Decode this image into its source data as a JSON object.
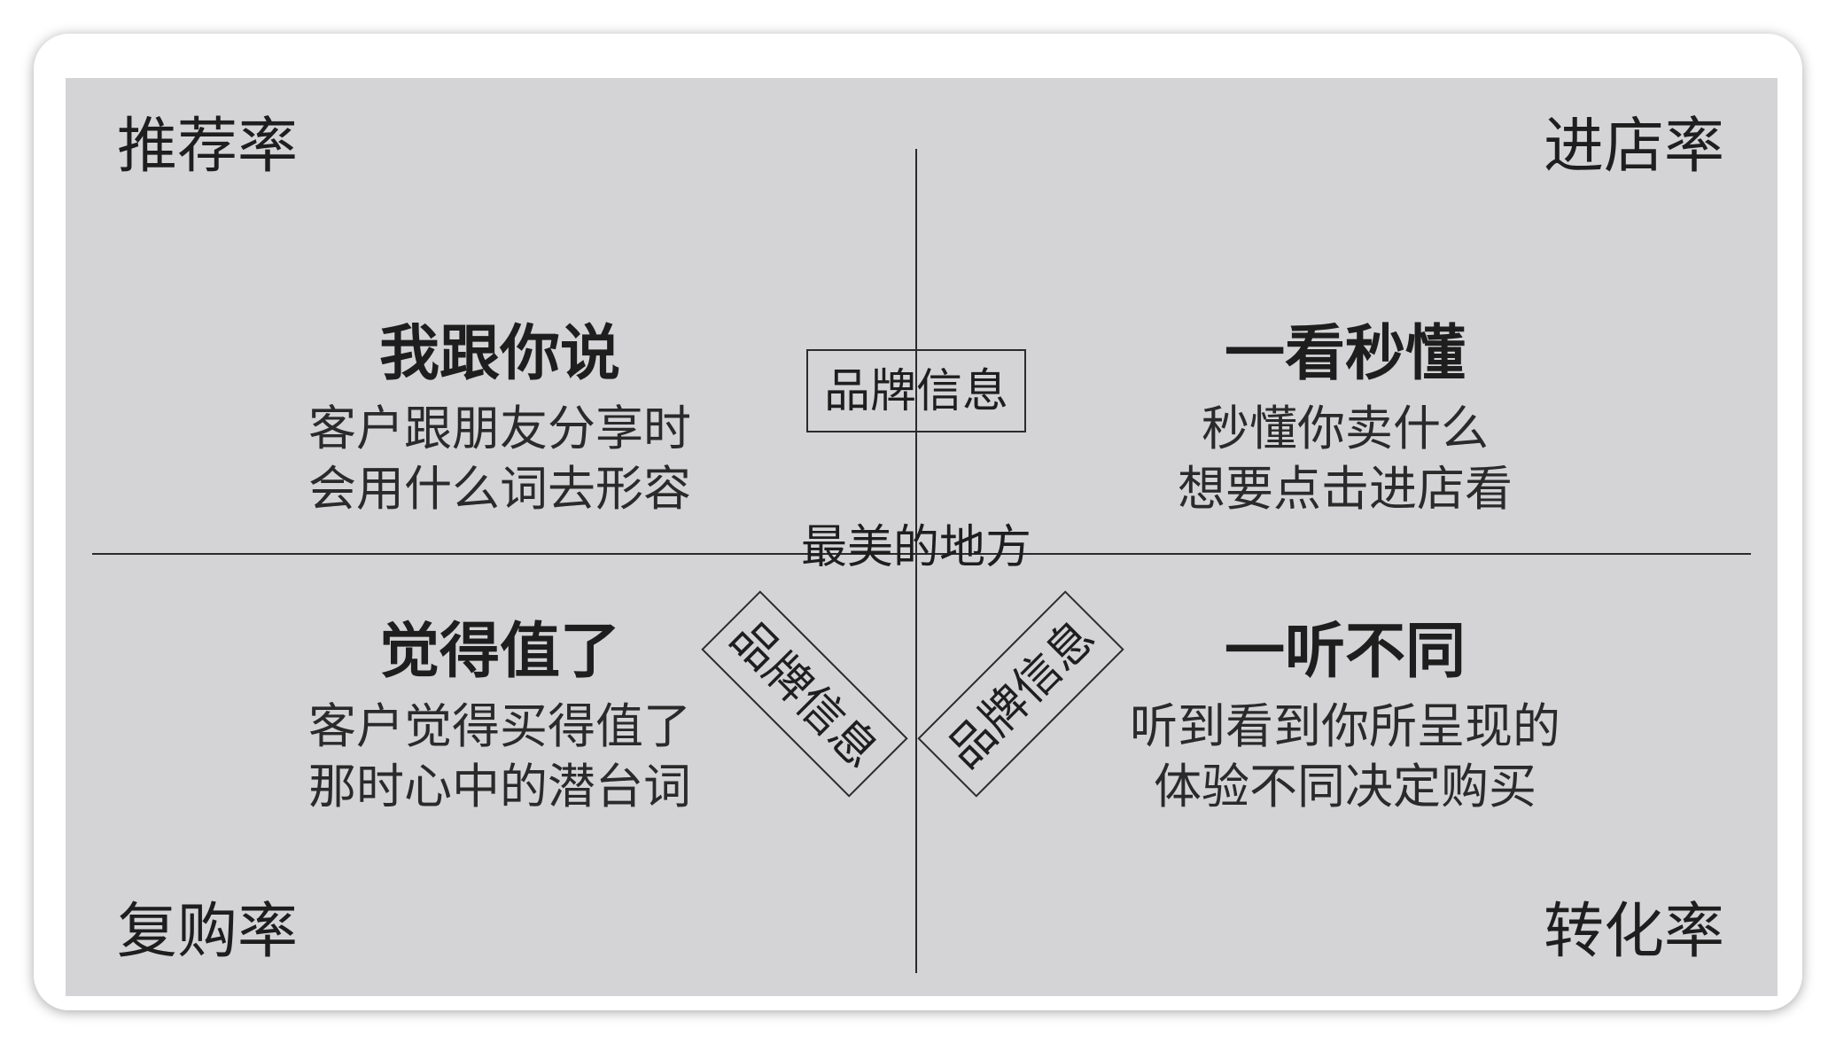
{
  "corners": {
    "top_left": "推荐率",
    "top_right": "进店率",
    "bottom_left": "复购率",
    "bottom_right": "转化率"
  },
  "quadrants": {
    "top_left": {
      "title": "我跟你说",
      "lines": [
        "客户跟朋友分享时",
        "会用什么词去形容"
      ]
    },
    "top_right": {
      "title": "一看秒懂",
      "lines": [
        "秒懂你卖什么",
        "想要点击进店看"
      ]
    },
    "bottom_left": {
      "title": "觉得值了",
      "lines": [
        "客户觉得买得值了",
        "那时心中的潜台词"
      ]
    },
    "bottom_right": {
      "title": "一听不同",
      "lines": [
        "听到看到你所呈现的",
        "体验不同决定购买"
      ]
    }
  },
  "center": {
    "label": "最美的地方",
    "brand_boxes": [
      "品牌信息",
      "品牌信息",
      "品牌信息"
    ]
  }
}
